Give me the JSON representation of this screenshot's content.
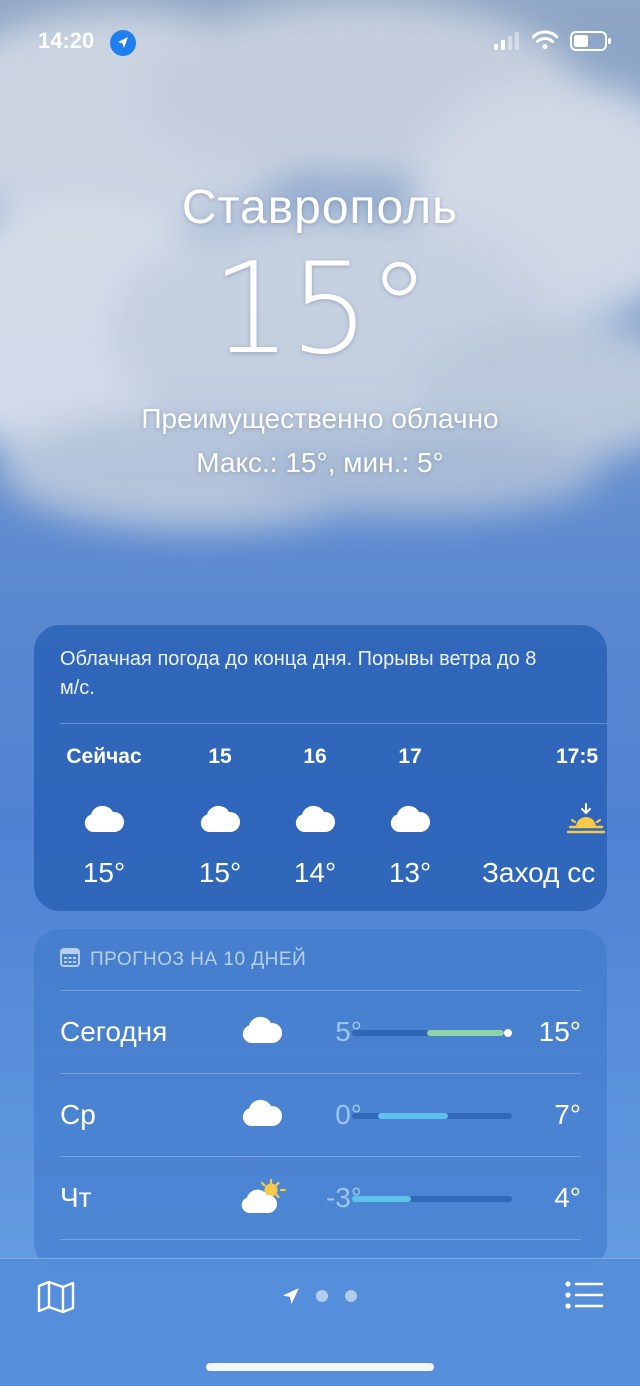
{
  "status_bar": {
    "time": "14:20"
  },
  "location": {
    "city": "Ставрополь",
    "temperature": "15°",
    "condition": "Преимущественно облачно",
    "high_low": "Макс.: 15°, мин.: 5°"
  },
  "hourly": {
    "summary": "Облачная погода до конца дня. Порывы ветра до 8 м/с.",
    "hours": [
      {
        "label": "Сейчас",
        "temp": "15°",
        "icon": "cloud-icon"
      },
      {
        "label": "15",
        "temp": "15°",
        "icon": "cloud-icon"
      },
      {
        "label": "16",
        "temp": "14°",
        "icon": "cloud-icon"
      },
      {
        "label": "17",
        "temp": "13°",
        "icon": "cloud-icon"
      },
      {
        "label": "17:5",
        "temp": "Заход сс",
        "icon": "sunset-icon"
      }
    ]
  },
  "forecast": {
    "title": "ПРОГНОЗ НА 10 ДНЕЙ",
    "days": [
      {
        "day": "Сегодня",
        "low": "5°",
        "high": "15°",
        "icon": "cloud-icon",
        "bar_start": 0.47,
        "bar_end": 0.95,
        "current_marker": true
      },
      {
        "day": "Ср",
        "low": "0°",
        "high": "7°",
        "icon": "cloud-icon",
        "bar_start": 0.16,
        "bar_end": 0.6,
        "current_marker": false
      },
      {
        "day": "Чт",
        "low": "-3°",
        "high": "4°",
        "icon": "partly-sunny-icon",
        "bar_start": 0.0,
        "bar_end": 0.37,
        "current_marker": false
      }
    ]
  },
  "colors": {
    "bar_today": "#8fd3a6",
    "bar_cold": "#5ec3ec",
    "low_temp_text": "#9cc4f0",
    "location_dot": "#1f7ef0"
  },
  "toolbar": {
    "page_dots": 2
  }
}
